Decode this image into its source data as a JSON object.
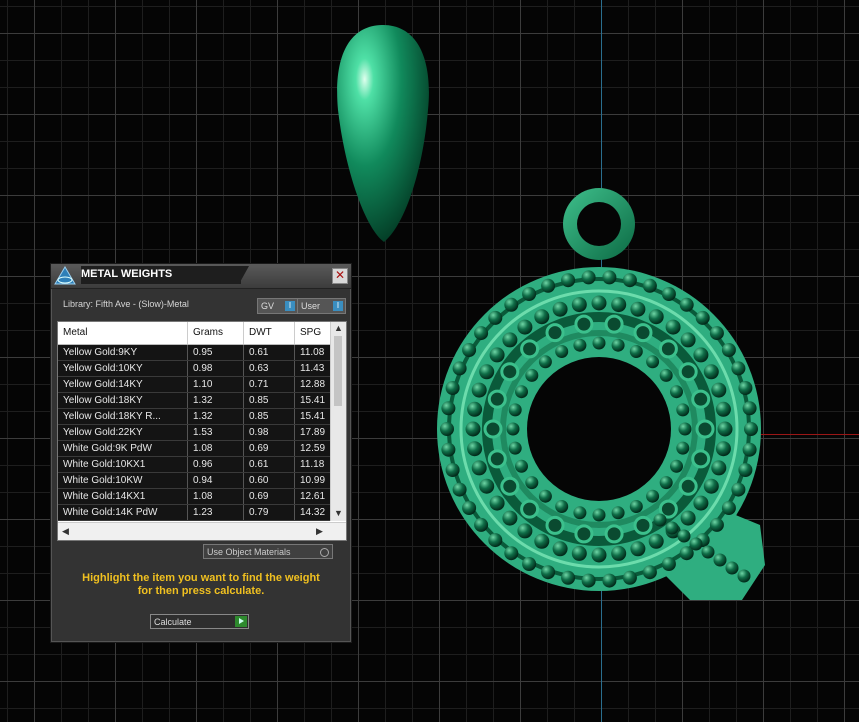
{
  "panel": {
    "title": "METAL WEIGHTS",
    "close_glyph": "✕",
    "library_label": "Library: Fifth Ave - (Slow)-Metal",
    "toggles": [
      {
        "label": "GV",
        "knob": "I"
      },
      {
        "label": "User",
        "knob": "I"
      }
    ],
    "table": {
      "columns": [
        "Metal",
        "Grams",
        "DWT",
        "SPG"
      ],
      "rows": [
        [
          "Yellow Gold:9KY",
          "0.95",
          "0.61",
          "11.08"
        ],
        [
          "Yellow Gold:10KY",
          "0.98",
          "0.63",
          "11.43"
        ],
        [
          "Yellow Gold:14KY",
          "1.10",
          "0.71",
          "12.88"
        ],
        [
          "Yellow Gold:18KY",
          "1.32",
          "0.85",
          "15.41"
        ],
        [
          "Yellow Gold:18KY R...",
          "1.32",
          "0.85",
          "15.41"
        ],
        [
          "Yellow Gold:22KY",
          "1.53",
          "0.98",
          "17.89"
        ],
        [
          "White Gold:9K PdW",
          "1.08",
          "0.69",
          "12.59"
        ],
        [
          "White Gold:10KX1",
          "0.96",
          "0.61",
          "11.18"
        ],
        [
          "White Gold:10KW",
          "0.94",
          "0.60",
          "10.99"
        ],
        [
          "White Gold:14KX1",
          "1.08",
          "0.69",
          "12.61"
        ],
        [
          "White Gold:14K PdW",
          "1.23",
          "0.79",
          "14.32"
        ]
      ]
    },
    "use_object_materials": "Use Object Materials",
    "instruction_line1": "Highlight the item you want to find the weight",
    "instruction_line2": "for then press calculate.",
    "calculate_label": "Calculate"
  },
  "colors": {
    "model_green": "#1f9a6c",
    "highlight_yellow": "#f0c020",
    "axis_blue": "#2a6e8e",
    "axis_red": "#9a1616"
  },
  "icons": {
    "app_logo": "app-logo-icon",
    "close": "close-icon",
    "calculate": "play-arrow-icon"
  }
}
